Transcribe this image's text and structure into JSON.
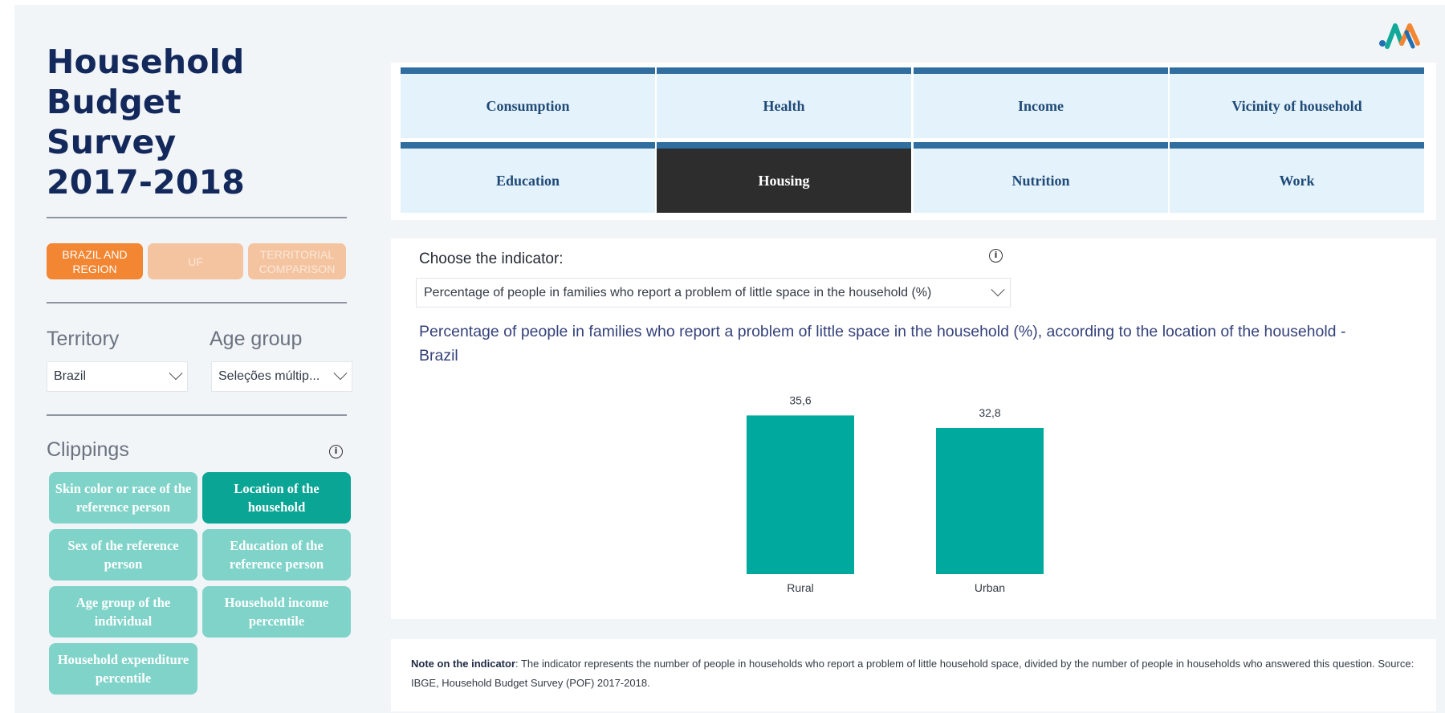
{
  "page_title": [
    "Household",
    "Budget",
    "Survey",
    "2017-2018"
  ],
  "scope_buttons": [
    {
      "label": "BRAZIL AND REGION",
      "active": true
    },
    {
      "label": "UF",
      "active": false
    },
    {
      "label": "TERRITORIAL COMPARISON",
      "active": false
    }
  ],
  "filters": {
    "territory": {
      "label": "Territory",
      "value": "Brazil"
    },
    "age_group": {
      "label": "Age group",
      "value": "Seleções múltip..."
    }
  },
  "clippings": {
    "title": "Clippings",
    "items": [
      {
        "label": "Skin color or race of the reference person",
        "active": false
      },
      {
        "label": "Location of the household",
        "active": true
      },
      {
        "label": "Sex of the reference person",
        "active": false
      },
      {
        "label": "Education of the reference person",
        "active": false
      },
      {
        "label": "Age group of the individual",
        "active": false
      },
      {
        "label": "Household income percentile",
        "active": false
      },
      {
        "label": "Household expenditure percentile",
        "active": false
      }
    ]
  },
  "tabs": [
    {
      "label": "Consumption",
      "active": false
    },
    {
      "label": "Health",
      "active": false
    },
    {
      "label": "Income",
      "active": false
    },
    {
      "label": "Vicinity of household",
      "active": false
    },
    {
      "label": "Education",
      "active": false
    },
    {
      "label": "Housing",
      "active": true
    },
    {
      "label": "Nutrition",
      "active": false
    },
    {
      "label": "Work",
      "active": false
    }
  ],
  "indicator": {
    "label": "Choose the indicator:",
    "value": "Percentage of people in families who report a problem of little space in the household (%)"
  },
  "chart_title": "Percentage of people in families who report a problem of little space in the household (%), according to the location of the household - Brazil",
  "chart_data": {
    "type": "bar",
    "categories": [
      "Rural",
      "Urban"
    ],
    "values": [
      35.6,
      32.8
    ],
    "value_labels": [
      "35,6",
      "32,8"
    ],
    "title": "Percentage of people in families who report a problem of little space in the household (%), according to the location of the household - Brazil",
    "xlabel": "",
    "ylabel": "",
    "ylim": [
      0,
      40
    ],
    "grid": false,
    "color": "#00a99d"
  },
  "note": {
    "label": "Note on the indicator",
    "text": ": The indicator represents the number of people in households who report a problem of little household space, divided by the number of people in households who answered this question. Source: IBGE, Household Budget Survey (POF) 2017-2018."
  },
  "colors": {
    "scope_active": "#f28632",
    "scope_inactive": "#f4c4a1",
    "clip_active": "#0aa595",
    "clip_inactive": "#7fd3c9",
    "tab_accent": "#2f6e9e",
    "tab_active_bg": "#2d2d2d",
    "title": "#13285b"
  },
  "icons": {
    "info": "info-icon",
    "dropdown": "chevron-down-icon",
    "logo": "brand-logo"
  }
}
